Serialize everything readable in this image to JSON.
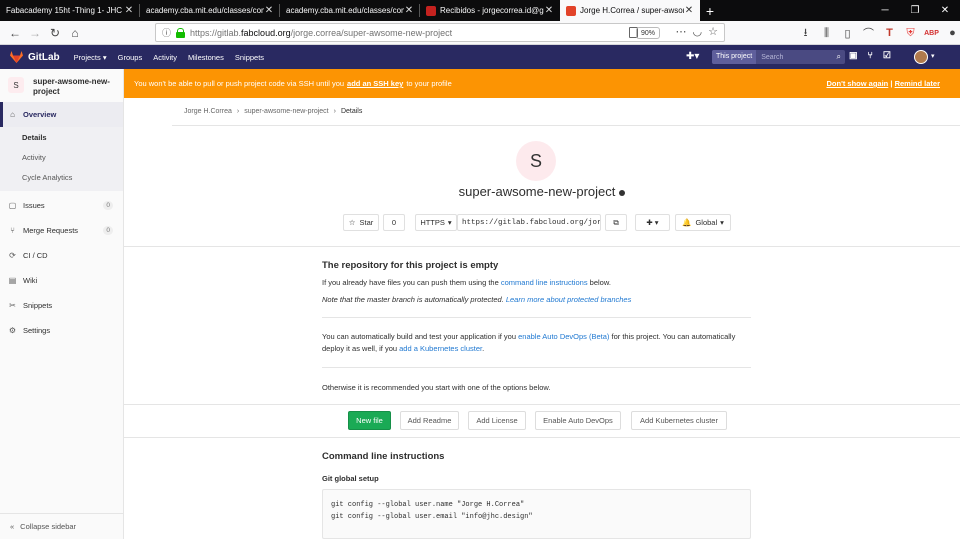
{
  "browser": {
    "tabs": [
      {
        "title": "Fabacademy 15ht -Thing 1- JHC",
        "active": false,
        "favicon": "none"
      },
      {
        "title": "academy.cba.mit.edu/classes/comp",
        "active": false,
        "favicon": "none"
      },
      {
        "title": "academy.cba.mit.edu/classes/comp",
        "active": false,
        "favicon": "none"
      },
      {
        "title": "Recibidos - jorgecorrea.id@gm",
        "active": false,
        "favicon": "mail-icon"
      },
      {
        "title": "Jorge H.Correa / super-awsome",
        "active": true,
        "favicon": "gitlab-icon"
      }
    ],
    "url_prefix": "https://gitlab.",
    "url_host": "fabcloud.org",
    "url_path": "/jorge.correa/super-awsome-new-project",
    "zoom": "90%"
  },
  "gitlab": {
    "brand": "GitLab",
    "nav": [
      "Projects ▾",
      "Groups",
      "Activity",
      "Milestones",
      "Snippets"
    ],
    "search_scope": "This project",
    "search_placeholder": "Search",
    "accent": "#292961"
  },
  "sidebar": {
    "project_avatar": "S",
    "project_name": "super-awsome-new-project",
    "overview": "Overview",
    "sub_items": [
      "Details",
      "Activity",
      "Cycle Analytics"
    ],
    "items": [
      {
        "label": "Issues",
        "badge": "0",
        "icon": "issues-icon"
      },
      {
        "label": "Merge Requests",
        "badge": "0",
        "icon": "merge-request-icon"
      },
      {
        "label": "CI / CD",
        "icon": "rocket-icon"
      },
      {
        "label": "Wiki",
        "icon": "book-icon"
      },
      {
        "label": "Snippets",
        "icon": "scissors-icon"
      },
      {
        "label": "Settings",
        "icon": "gear-icon"
      }
    ],
    "collapse": "Collapse sidebar"
  },
  "banner": {
    "text_before": "You won't be able to pull or push project code via SSH until you ",
    "link": "add an SSH key",
    "text_after": " to your profile",
    "dont_show": "Don't show again",
    "separator": " | ",
    "remind": "Remind later",
    "color": "#fc9403"
  },
  "breadcrumb": [
    "Jorge H.Correa",
    "super-awsome-new-project",
    "Details"
  ],
  "project": {
    "avatar": "S",
    "title": "super-awsome-new-project",
    "star_label": "Star",
    "star_count": "0",
    "clone_protocol": "HTTPS",
    "clone_url": "https://gitlab.fabcloud.org/jor",
    "notification": "Global"
  },
  "empty": {
    "heading": "The repository for this project is empty",
    "line1_before": "If you already have files you can push them using the ",
    "line1_link": "command line instructions",
    "line1_after": " below.",
    "line2_before": "Note that the master branch is automatically protected. ",
    "line2_link": "Learn more about protected branches",
    "devops_before": "You can automatically build and test your application if you ",
    "devops_link": "enable Auto DevOps (Beta)",
    "devops_mid": " for this project. You can automatically deploy it as well, if you ",
    "devops_link2": "add a Kubernetes cluster",
    "devops_end": ".",
    "otherwise": "Otherwise it is recommended you start with one of the options below."
  },
  "options": [
    "New file",
    "Add Readme",
    "Add License",
    "Enable Auto DevOps",
    "Add Kubernetes cluster"
  ],
  "cli": {
    "heading": "Command line instructions",
    "git_global": "Git global setup",
    "code_line1": "git config --global user.name \"Jorge H.Correa\"",
    "code_line2": "git config --global user.email \"info@jhc.design\""
  }
}
